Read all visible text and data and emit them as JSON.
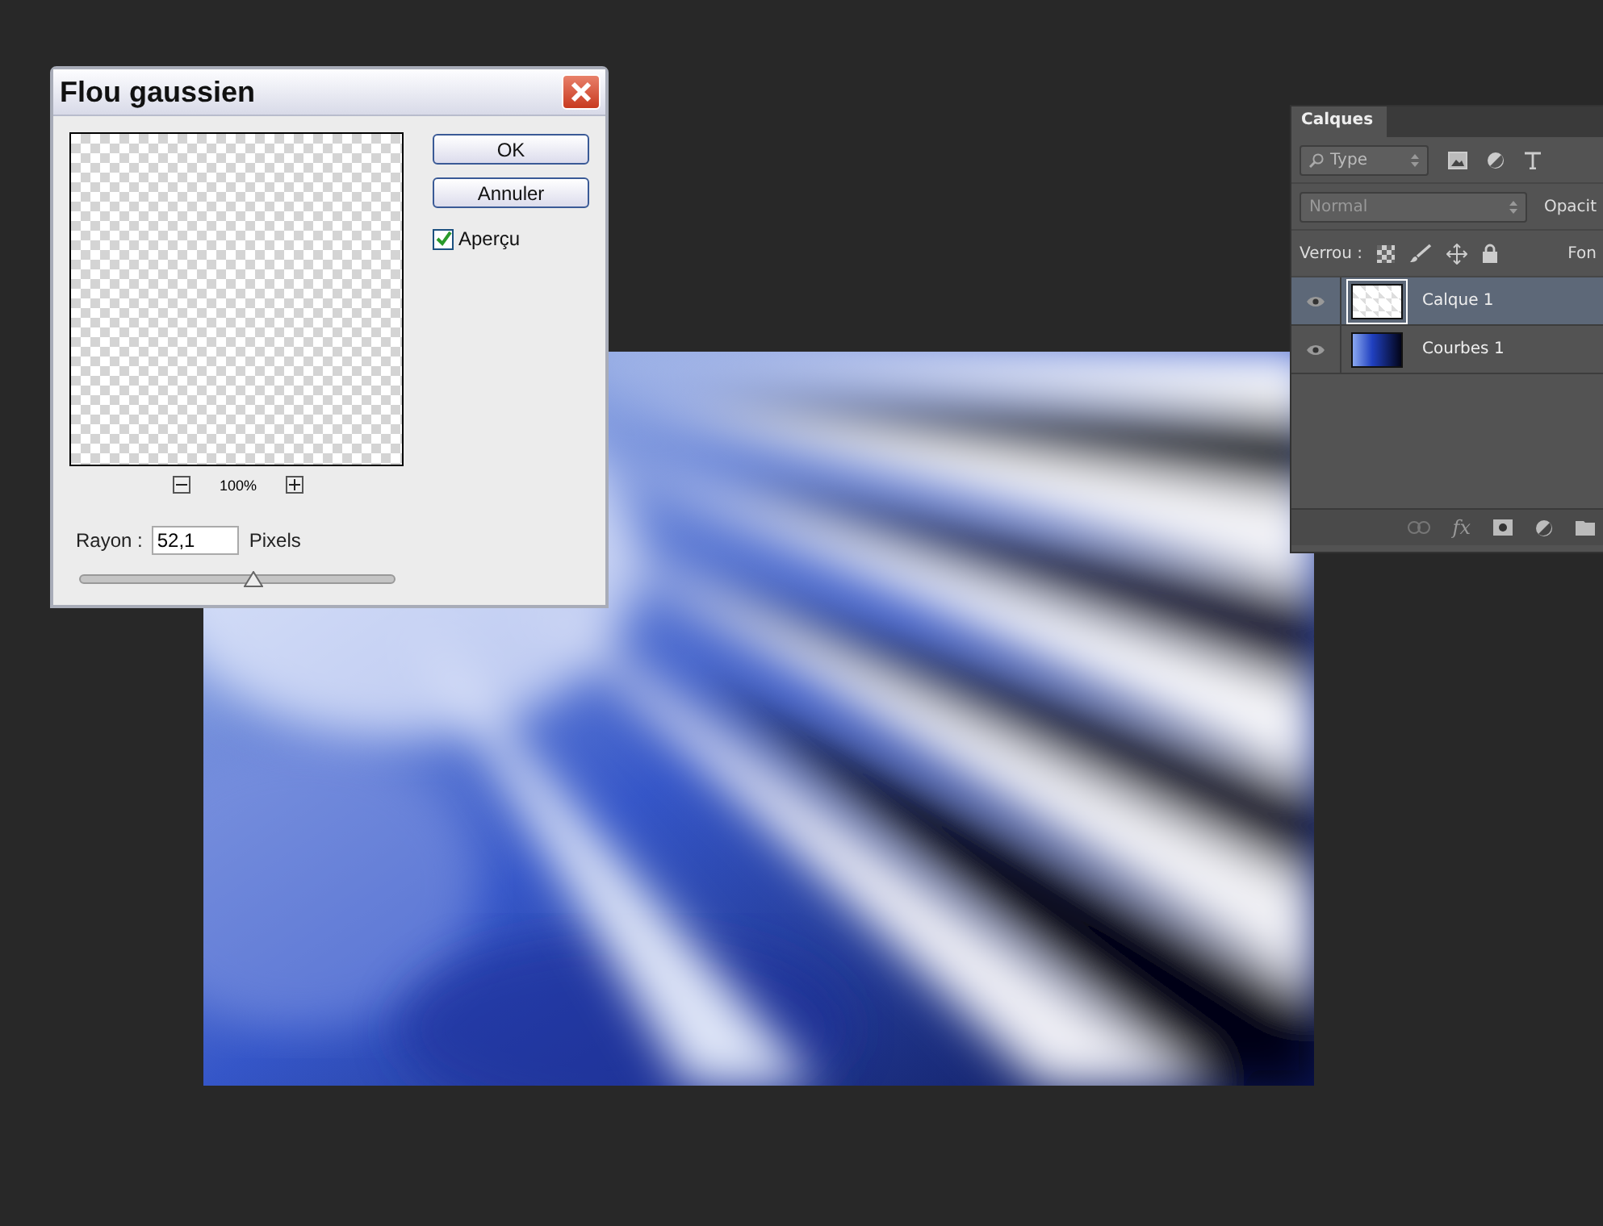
{
  "dialog": {
    "title": "Flou gaussien",
    "buttons": [
      "OK",
      "Annuler"
    ],
    "preview": {
      "label": "Aperçu",
      "checked": true
    },
    "zoom": "100%",
    "radius": {
      "label": "Rayon :",
      "value": "52,1",
      "unit": "Pixels",
      "level": 0.55
    }
  },
  "layers_panel": {
    "tab": "Calques",
    "filter": "Type",
    "blend_mode": "Normal",
    "opacity_label": "Opacit",
    "lock_label": "Verrou :",
    "fill_label": "Fon",
    "fx": "fx",
    "layers": [
      {
        "name": "Calque 1",
        "selected": true,
        "visible": true,
        "kind": "transparent"
      },
      {
        "name": "Courbes 1",
        "selected": false,
        "visible": true,
        "kind": "gradient"
      }
    ]
  }
}
